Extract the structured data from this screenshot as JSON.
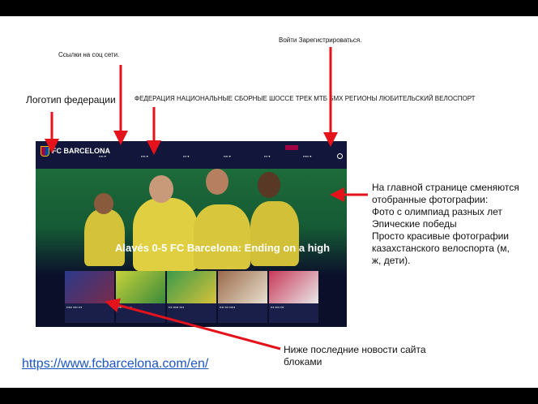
{
  "annotations": {
    "social_links": "Ссылки на соц сети.",
    "login_register": "Войти  Зарегистрироваться.",
    "federation_logo": "Логотип федерации",
    "main_menu": "ФЕДЕРАЦИЯ НАЦИОНАЛЬНЫЕ СБОРНЫЕ   ШОССЕ  ТРЕК   МТБ   БМХ   РЕГИОНЫ  ЛЮБИТЕЛЬСКИЙ ВЕЛОСПОРТ",
    "hero_description": [
      "На главной странице сменяются",
      "отобранные фотографии:",
      "Фото с олимпиад разных лет",
      "Эпические победы",
      "Просто красивые фотографии",
      "казахстанского велоспорта (м,",
      "ж, дети)."
    ],
    "news_blocks": "Ниже последние новости сайта блоками"
  },
  "link": "https://www.fcbarcelona.com/en/",
  "screenshot": {
    "logo_text": "FC BARCELONA",
    "headline": "Alavés 0-5 FC Barcelona: Ending on a high"
  },
  "colors": {
    "arrow": "#e3121b",
    "nav": "#11163a",
    "link": "#1a56c8"
  }
}
